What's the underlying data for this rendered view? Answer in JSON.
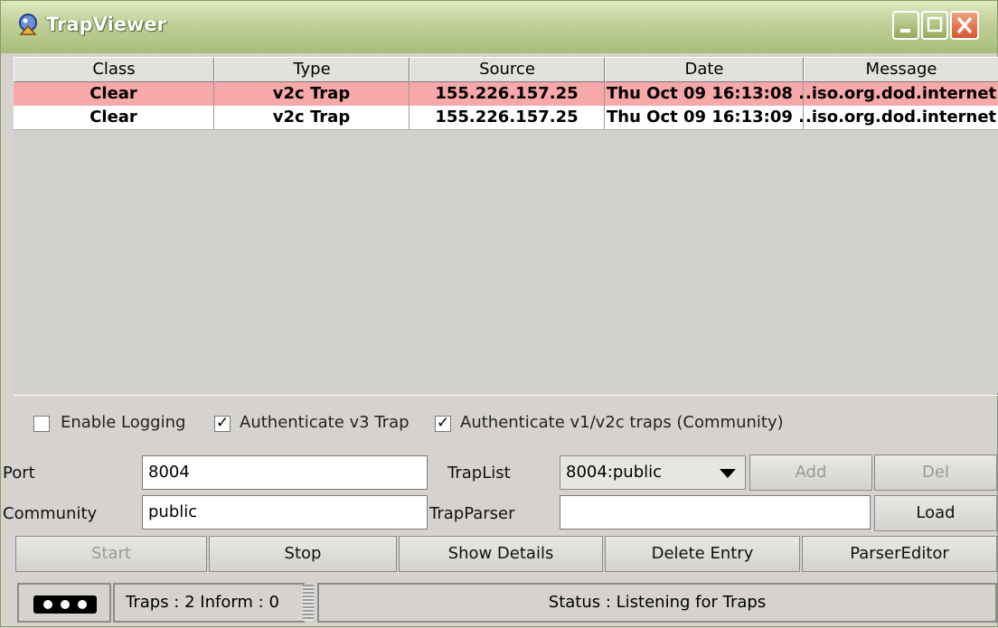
{
  "window": {
    "title": "TrapViewer",
    "icon": "trap-viewer-icon"
  },
  "table": {
    "columns": [
      "Class",
      "Type",
      "Source",
      "Date",
      "Message"
    ],
    "rows": [
      {
        "class": "Clear",
        "type": "v2c Trap",
        "source": "155.226.157.25",
        "date": "Thu Oct 09 16:13:08 ...",
        "message": ".iso.org.dod.internet...",
        "selected": true
      },
      {
        "class": "Clear",
        "type": "v2c Trap",
        "source": "155.226.157.25",
        "date": "Thu Oct 09 16:13:09 ...",
        "message": ".iso.org.dod.internet...",
        "selected": false
      }
    ]
  },
  "options": {
    "enable_logging": {
      "label": "Enable Logging",
      "checked": false
    },
    "auth_v3": {
      "label": "Authenticate v3 Trap",
      "checked": true
    },
    "auth_v1v2c": {
      "label": "Authenticate v1/v2c traps (Community)",
      "checked": true
    }
  },
  "form": {
    "port_label": "Port",
    "port_value": "8004",
    "community_label": "Community",
    "community_value": "public",
    "traplist_label": "TrapList",
    "traplist_value": "8004:public",
    "trapparser_label": "TrapParser",
    "trapparser_value": "",
    "add_label": "Add",
    "del_label": "Del",
    "load_label": "Load"
  },
  "actions": {
    "start": "Start",
    "stop": "Stop",
    "show_details": "Show Details",
    "delete_entry": "Delete Entry",
    "parser_editor": "ParserEditor"
  },
  "status": {
    "counts": "Traps :  2 Inform :  0",
    "message": "Status : Listening for Traps"
  },
  "colors": {
    "selected_row": "#f7a8a8",
    "titlebar": "#bfcf96",
    "close_button": "#d8542c"
  }
}
